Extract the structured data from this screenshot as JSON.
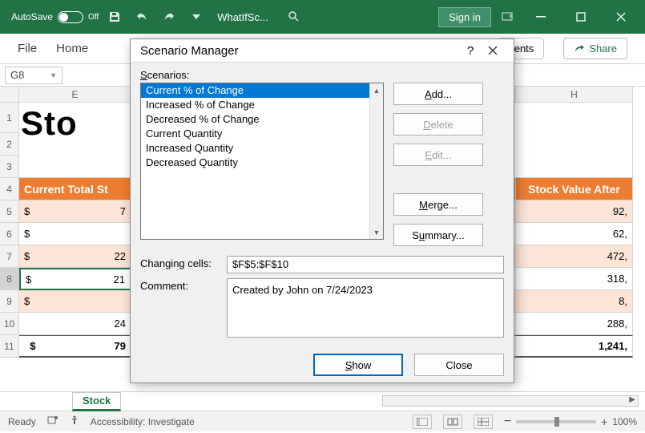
{
  "titlebar": {
    "autosave_label": "AutoSave",
    "autosave_state": "Off",
    "window_title": "WhatIfSc...",
    "signin": "Sign in"
  },
  "ribbon": {
    "file": "File",
    "home": "Home",
    "truncated": "nents",
    "share": "Share"
  },
  "name_box": "G8",
  "columns": {
    "E": "E",
    "H": "H"
  },
  "row_headers": [
    "1",
    "2",
    "3",
    "4",
    "5",
    "6",
    "7",
    "8",
    "9",
    "10",
    "11"
  ],
  "big_title": "Sto",
  "header_E": "Current Total St",
  "header_H": "Stock Value After",
  "cells_E": [
    "$",
    "$",
    "$",
    "$",
    "$",
    "",
    ""
  ],
  "cells_E_right": [
    "7",
    "",
    "22",
    "21",
    "",
    "24",
    "79"
  ],
  "cells_H": [
    "92,",
    "62,",
    "472,",
    "318,",
    "8,",
    "288,",
    "1,241,"
  ],
  "sheet_tab": "Stock",
  "status": {
    "ready": "Ready",
    "access": "Accessibility: Investigate",
    "zoom": "100%"
  },
  "dialog": {
    "title": "Scenario Manager",
    "scenarios_label_pre": "S",
    "scenarios_label_post": "cenarios:",
    "scenarios": [
      "Current % of Change",
      "Increased % of Change",
      "Decreased % of Change",
      "Current Quantity",
      "Increased Quantity",
      "Decreased Quantity"
    ],
    "btn_add_pre": "A",
    "btn_add_post": "dd...",
    "btn_delete_pre": "D",
    "btn_delete_post": "elete",
    "btn_edit_pre": "E",
    "btn_edit_post": "dit...",
    "btn_merge_pre": "M",
    "btn_merge_post": "erge...",
    "btn_summary_pre": "S",
    "btn_summary_post": "ummary...",
    "changing_label": "Changing cells:",
    "changing_value": "$F$5:$F$10",
    "comment_label": "Comment:",
    "comment_value": "Created by John on 7/24/2023",
    "show_pre": "S",
    "show_post": "how",
    "close": "Close"
  }
}
